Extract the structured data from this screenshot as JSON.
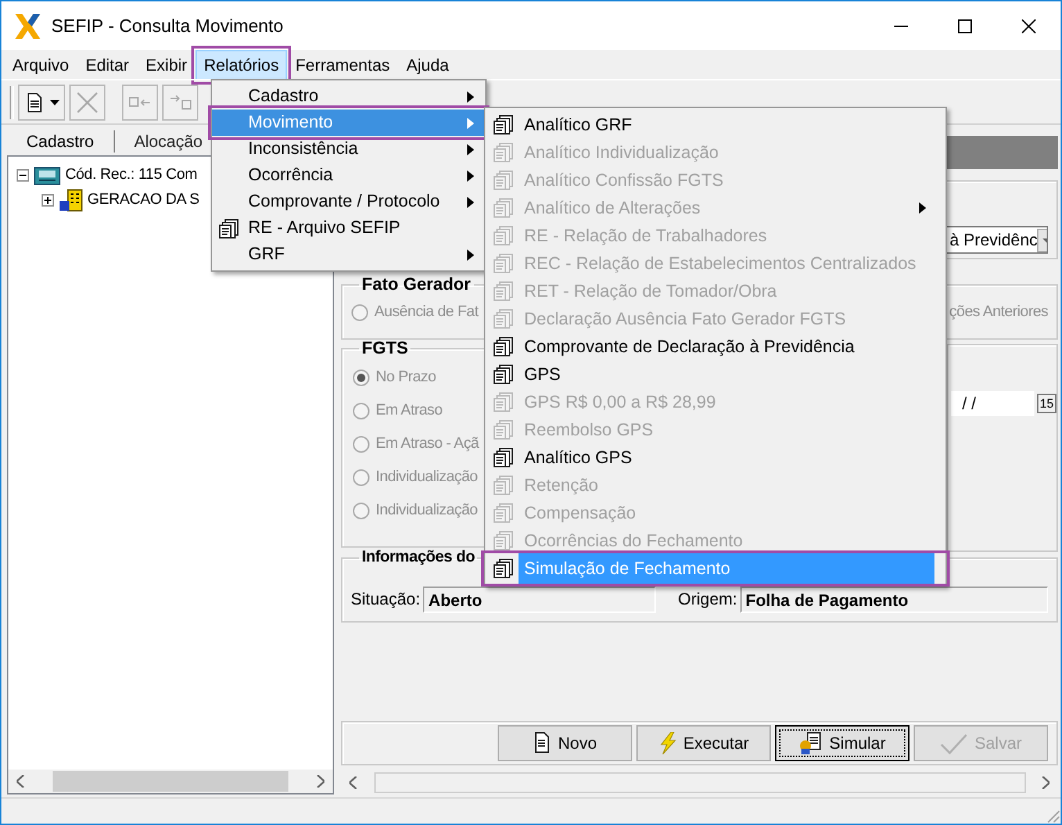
{
  "window": {
    "title": "SEFIP - Consulta Movimento"
  },
  "menubar": [
    {
      "label": "Arquivo",
      "selected": false,
      "annotated": false
    },
    {
      "label": "Editar",
      "selected": false,
      "annotated": false
    },
    {
      "label": "Exibir",
      "selected": false,
      "annotated": false
    },
    {
      "label": "Relatórios",
      "selected": true,
      "annotated": true
    },
    {
      "label": "Ferramentas",
      "selected": false,
      "annotated": false
    },
    {
      "label": "Ajuda",
      "selected": false,
      "annotated": false
    }
  ],
  "toolbar": [
    {
      "kind": "new",
      "disabled": false
    },
    {
      "kind": "delete",
      "disabled": true
    },
    {
      "kind": "move-left",
      "disabled": true
    },
    {
      "kind": "move-right",
      "disabled": true
    }
  ],
  "left_tabs": [
    {
      "label": "Cadastro",
      "selected": true
    },
    {
      "label": "Alocação",
      "selected": false
    }
  ],
  "tree": [
    {
      "label": "Cód. Rec.: 115 Com",
      "kind": "register",
      "expanded": true,
      "children": [
        {
          "label": "GERACAO DA S",
          "kind": "company",
          "expanded": false
        }
      ]
    }
  ],
  "combo": {
    "value": "à Previdênc"
  },
  "fato_gerador": {
    "title": "Fato Gerador",
    "options": [
      {
        "label": "Ausência de Fat",
        "selected": false,
        "disabled": true
      }
    ],
    "right_text": "ções Anteriores"
  },
  "fgts": {
    "title": "FGTS",
    "options": [
      {
        "label": "No Prazo",
        "selected": true,
        "disabled": true
      },
      {
        "label": "Em Atraso",
        "selected": false,
        "disabled": true
      },
      {
        "label": "Em Atraso - Açã",
        "selected": false,
        "disabled": true
      },
      {
        "label": "Individualização",
        "selected": false,
        "disabled": true
      },
      {
        "label": "Individualização",
        "selected": false,
        "disabled": true
      }
    ]
  },
  "date_field": {
    "value": "/  /",
    "button": "15"
  },
  "info": {
    "title": "Informações do",
    "situacao_label": "Situação:",
    "situacao": "Aberto",
    "origem_label": "Origem:",
    "origem": "Folha de Pagamento"
  },
  "buttons": [
    {
      "label": "Novo",
      "kind": "new",
      "disabled": false,
      "focused": false
    },
    {
      "label": "Executar",
      "kind": "run",
      "disabled": false,
      "focused": false
    },
    {
      "label": "Simular",
      "kind": "simulate",
      "disabled": false,
      "focused": true
    },
    {
      "label": "Salvar",
      "kind": "save",
      "disabled": true,
      "focused": false
    }
  ],
  "menu": [
    {
      "label": "Cadastro",
      "kind": "submenu",
      "selected": false,
      "annotated": false
    },
    {
      "label": "Movimento",
      "kind": "submenu",
      "selected": true,
      "annotated": true
    },
    {
      "label": "Inconsistência",
      "kind": "submenu",
      "selected": false,
      "annotated": false
    },
    {
      "label": "Ocorrência",
      "kind": "submenu",
      "selected": false,
      "annotated": false
    },
    {
      "label": "Comprovante / Protocolo",
      "kind": "submenu",
      "selected": false,
      "annotated": false
    },
    {
      "label": "RE - Arquivo SEFIP",
      "kind": "report",
      "selected": false,
      "annotated": false
    },
    {
      "label": "GRF",
      "kind": "submenu",
      "selected": false,
      "annotated": false
    }
  ],
  "submenu": [
    {
      "label": "Analítico GRF",
      "kind": "report",
      "disabled": false,
      "selected": false,
      "annotated": false
    },
    {
      "label": "Analítico Individualização",
      "kind": "report",
      "disabled": true,
      "selected": false,
      "annotated": false
    },
    {
      "label": "Analítico Confissão FGTS",
      "kind": "report",
      "disabled": true,
      "selected": false,
      "annotated": false
    },
    {
      "label": "Analítico de Alterações",
      "kind": "submenu",
      "disabled": true,
      "selected": false,
      "annotated": false
    },
    {
      "label": "RE - Relação de Trabalhadores",
      "kind": "report",
      "disabled": true,
      "selected": false,
      "annotated": false
    },
    {
      "label": "REC - Relação de Estabelecimentos Centralizados",
      "kind": "report",
      "disabled": true,
      "selected": false,
      "annotated": false
    },
    {
      "label": "RET - Relação de Tomador/Obra",
      "kind": "report",
      "disabled": true,
      "selected": false,
      "annotated": false
    },
    {
      "label": "Declaração Ausência Fato Gerador FGTS",
      "kind": "report",
      "disabled": true,
      "selected": false,
      "annotated": false
    },
    {
      "label": "Comprovante de Declaração à Previdência",
      "kind": "report",
      "disabled": false,
      "selected": false,
      "annotated": false
    },
    {
      "label": "GPS",
      "kind": "report",
      "disabled": false,
      "selected": false,
      "annotated": false
    },
    {
      "label": "GPS R$ 0,00 a R$ 28,99",
      "kind": "report",
      "disabled": true,
      "selected": false,
      "annotated": false
    },
    {
      "label": "Reembolso GPS",
      "kind": "report",
      "disabled": true,
      "selected": false,
      "annotated": false
    },
    {
      "label": "Analítico GPS",
      "kind": "report",
      "disabled": false,
      "selected": false,
      "annotated": false
    },
    {
      "label": "Retenção",
      "kind": "report",
      "disabled": true,
      "selected": false,
      "annotated": false
    },
    {
      "label": "Compensação",
      "kind": "report",
      "disabled": true,
      "selected": false,
      "annotated": false
    },
    {
      "label": "Ocorrências do Fechamento",
      "kind": "report",
      "disabled": true,
      "selected": false,
      "annotated": false
    },
    {
      "label": "Simulação de Fechamento",
      "kind": "report",
      "disabled": false,
      "selected": true,
      "annotated": true
    }
  ]
}
